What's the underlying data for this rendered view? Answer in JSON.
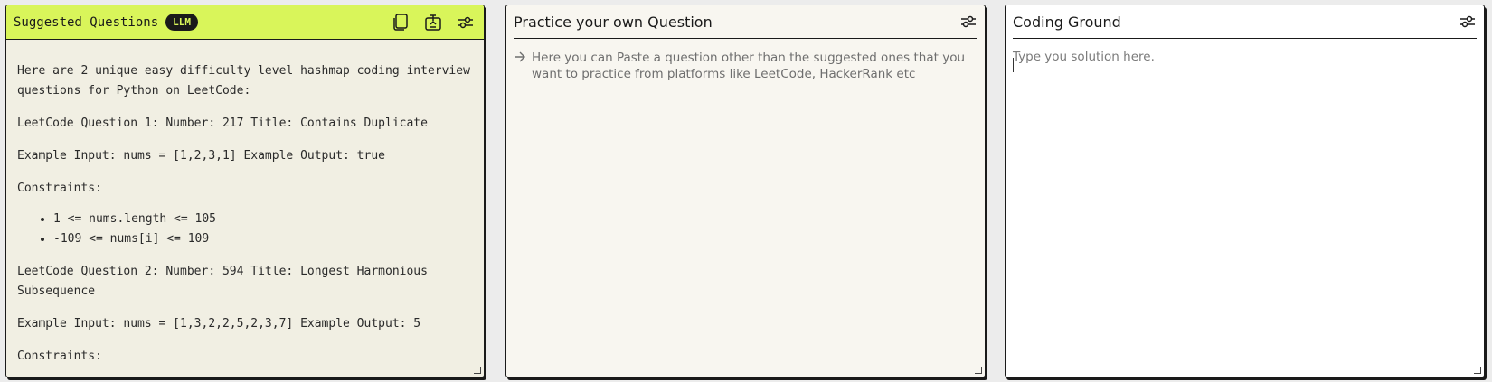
{
  "suggested_panel": {
    "title": "Suggested Questions",
    "badge": "LLM",
    "icons": [
      "copy-icon",
      "export-icon",
      "settings-sliders-icon"
    ],
    "intro": "Here are 2 unique easy difficulty level hashmap coding interview questions for Python on LeetCode:",
    "q1_title": "LeetCode Question 1: Number: 217 Title: Contains Duplicate",
    "q1_example": "Example Input: nums = [1,2,3,1] Example Output: true",
    "q1_constraints_label": "Constraints:",
    "q1_constraints": [
      "1 <= nums.length <= 105",
      "-109 <= nums[i] <= 109"
    ],
    "q2_title": "LeetCode Question 2: Number: 594 Title: Longest Harmonious Subsequence",
    "q2_example": "Example Input: nums = [1,3,2,2,5,2,3,7] Example Output: 5",
    "q2_constraints_label": "Constraints:"
  },
  "practice_panel": {
    "title": "Practice your own Question",
    "icon": "settings-sliders-icon",
    "hint": "Here you can Paste a question other than the suggested ones that you want to practice from platforms like LeetCode, HackerRank etc"
  },
  "coding_panel": {
    "title": "Coding Ground",
    "icon": "settings-sliders-icon",
    "placeholder": "Type you solution here.",
    "value": ""
  },
  "colors": {
    "accent": "#d9f55a",
    "border": "#1a1a1a",
    "panel_suggested_bg": "#f1efe3",
    "panel_practice_bg": "#f8f6f0",
    "panel_code_bg": "#ffffff"
  }
}
